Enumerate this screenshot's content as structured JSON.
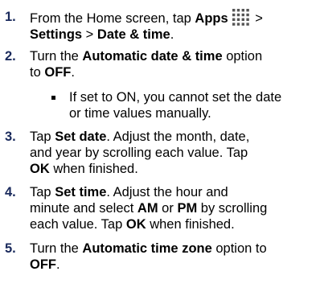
{
  "steps": [
    {
      "number": "1.",
      "l1_a": "From the Home screen, tap ",
      "l1_b": "Apps",
      "l1_c": " >",
      "l2_a": "Settings",
      "l2_b": " > ",
      "l2_c": "Date & time",
      "l2_d": "."
    },
    {
      "number": "2.",
      "l1_a": "Turn the ",
      "l1_b": "Automatic date & time",
      "l1_c": " option",
      "l2_a": "to ",
      "l2_b": "OFF",
      "l2_c": "."
    },
    {
      "number": "3.",
      "l1_a": "Tap ",
      "l1_b": "Set date",
      "l1_c": ". Adjust the month, date,",
      "l2": "and year by scrolling each value. Tap",
      "l3_a": "OK",
      "l3_b": " when finished."
    },
    {
      "number": "4.",
      "l1_a": "Tap ",
      "l1_b": "Set time",
      "l1_c": ". Adjust the hour and",
      "l2_a": "minute and select ",
      "l2_b": "AM",
      "l2_c": " or ",
      "l2_d": "PM",
      "l2_e": " by scrolling",
      "l3": "each value. Tap OK when finished.",
      "l3_a": "each value. Tap ",
      "l3_b": "OK",
      "l3_c": " when finished."
    },
    {
      "number": "5.",
      "l1_a": "Turn the ",
      "l1_b": "Automatic time zone",
      "l1_c": " option to",
      "l2_a": "OFF",
      "l2_b": "."
    }
  ],
  "note": {
    "l1": "If set to ON, you cannot set the date",
    "l2": "or time values manually."
  },
  "icons": {
    "apps": "apps-grid-icon"
  },
  "colors": {
    "step_number": "#1a2a5c",
    "text": "#000000",
    "background": "#ffffff"
  }
}
